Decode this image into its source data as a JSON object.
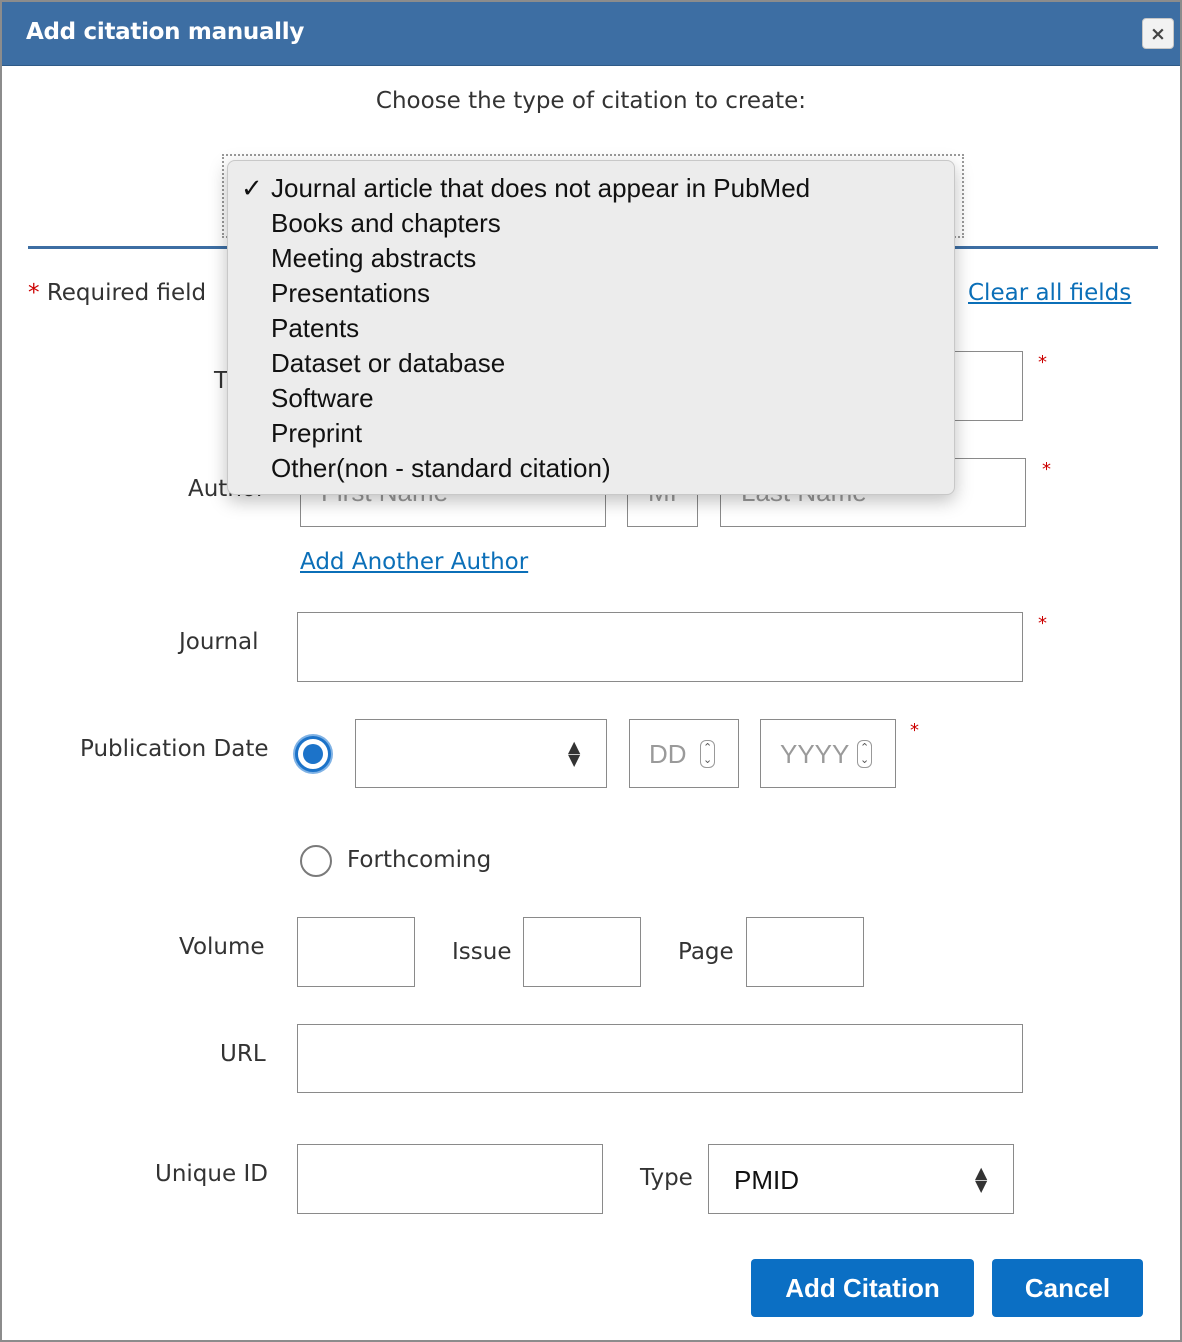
{
  "dialog": {
    "title": "Add citation manually",
    "close_icon": "×",
    "prompt": "Choose the type of citation to create:"
  },
  "citation_type": {
    "selected": "Journal article that does not appear in PubMed",
    "check_icon": "✓",
    "options": [
      "Journal article that does not appear in PubMed",
      "Books and chapters",
      "Meeting abstracts",
      "Presentations",
      "Patents",
      "Dataset or database",
      "Software",
      "Preprint",
      "Other(non - standard citation)"
    ]
  },
  "form": {
    "required_star": "*",
    "required_note": "Required field",
    "clear_all_label": "Clear all fields",
    "title_label_partial": "T",
    "author_label": "Author",
    "author_first_placeholder": "First Name",
    "author_mi_placeholder": "MI",
    "author_last_placeholder": "Last Name",
    "add_author_label": "Add Another Author",
    "journal_label": "Journal",
    "publication_date_label": "Publication Date",
    "month_value": "",
    "day_placeholder": "DD",
    "year_placeholder": "YYYY",
    "forthcoming_label": "Forthcoming",
    "date_option_selected": "date",
    "volume_label": "Volume",
    "issue_label": "Issue",
    "page_label": "Page",
    "url_label": "URL",
    "unique_id_label": "Unique ID",
    "type_label": "Type",
    "type_value": "PMID"
  },
  "buttons": {
    "add_citation": "Add Citation",
    "cancel": "Cancel"
  },
  "colors": {
    "header": "#3d6ea3",
    "primary_button": "#0b6fc4",
    "link": "#0b6fb8",
    "required": "#cc0000"
  }
}
